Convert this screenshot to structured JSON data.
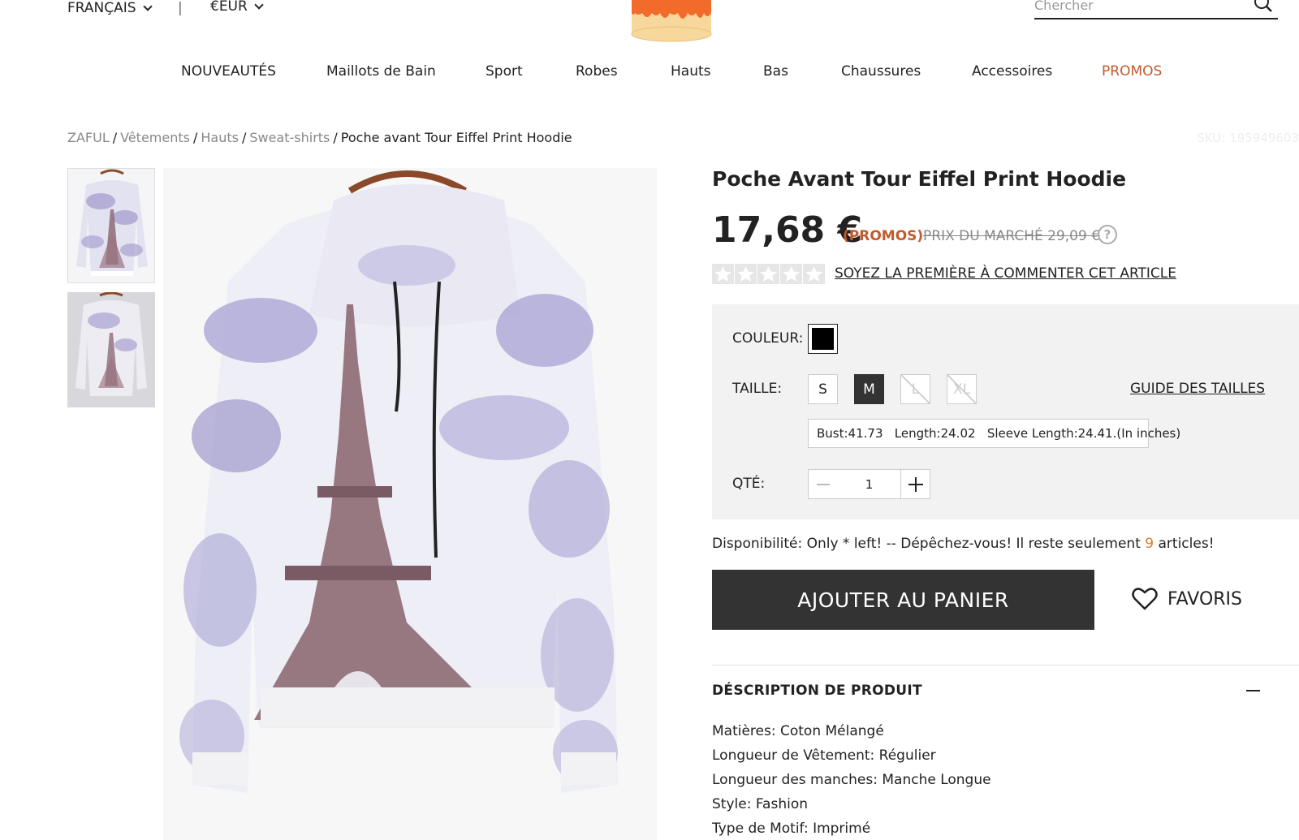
{
  "header": {
    "language": "FRANÇAIS",
    "separator": "|",
    "currency": "€EUR",
    "search_placeholder": "Chercher"
  },
  "nav": {
    "items": [
      {
        "label": "NOUVEAUTÉS"
      },
      {
        "label": "Maillots de Bain"
      },
      {
        "label": "Sport"
      },
      {
        "label": "Robes"
      },
      {
        "label": "Hauts"
      },
      {
        "label": "Bas"
      },
      {
        "label": "Chaussures"
      },
      {
        "label": "Accessoires"
      },
      {
        "label": "PROMOS"
      }
    ]
  },
  "breadcrumb": {
    "items": [
      "ZAFUL",
      "Vêtements",
      "Hauts",
      "Sweat-shirts"
    ],
    "current": "Poche avant Tour Eiffel Print Hoodie",
    "separator": "/",
    "sku": "SKU: 195949603"
  },
  "product": {
    "title": "Poche Avant Tour Eiffel Print Hoodie",
    "price": "17,68 €",
    "promo_tag": "(PROMOS)",
    "market_price": "PRIX DU MARCHÉ 29,09 €",
    "help": "?",
    "rating_stars": 0,
    "review_link": "SOYEZ LA PREMIÈRE À COMMENTER CET ARTICLE",
    "color_label": "COULEUR:",
    "size_label": "TAILLE:",
    "sizes": [
      "S",
      "M",
      "L",
      "XL"
    ],
    "selected_size": "M",
    "size_guide": "GUIDE DES TAILLES",
    "measurements": "Bust:41.73   Length:24.02   Sleeve Length:24.41.(In inches)",
    "qty_label": "QTÉ:",
    "qty_value": "1",
    "availability_prefix": "Disponibilité: Only * left! -- Dépêchez-vous! Il reste seulement ",
    "availability_count": "9",
    "availability_suffix": " articles!",
    "add_to_cart": "AJOUTER AU PANIER",
    "favorites": "FAVORIS",
    "description_title": "DÉSCRIPTION DE PRODUIT",
    "description": [
      "Matières: Coton Mélangé",
      "Longueur de Vêtement: Régulier",
      "Longueur des manches: Manche Longue",
      "Style: Fashion",
      "Type de Motif: Imprimé"
    ]
  },
  "colors": {
    "accent": "#c25a2c",
    "button": "#333333",
    "stock": "#e07b22"
  }
}
